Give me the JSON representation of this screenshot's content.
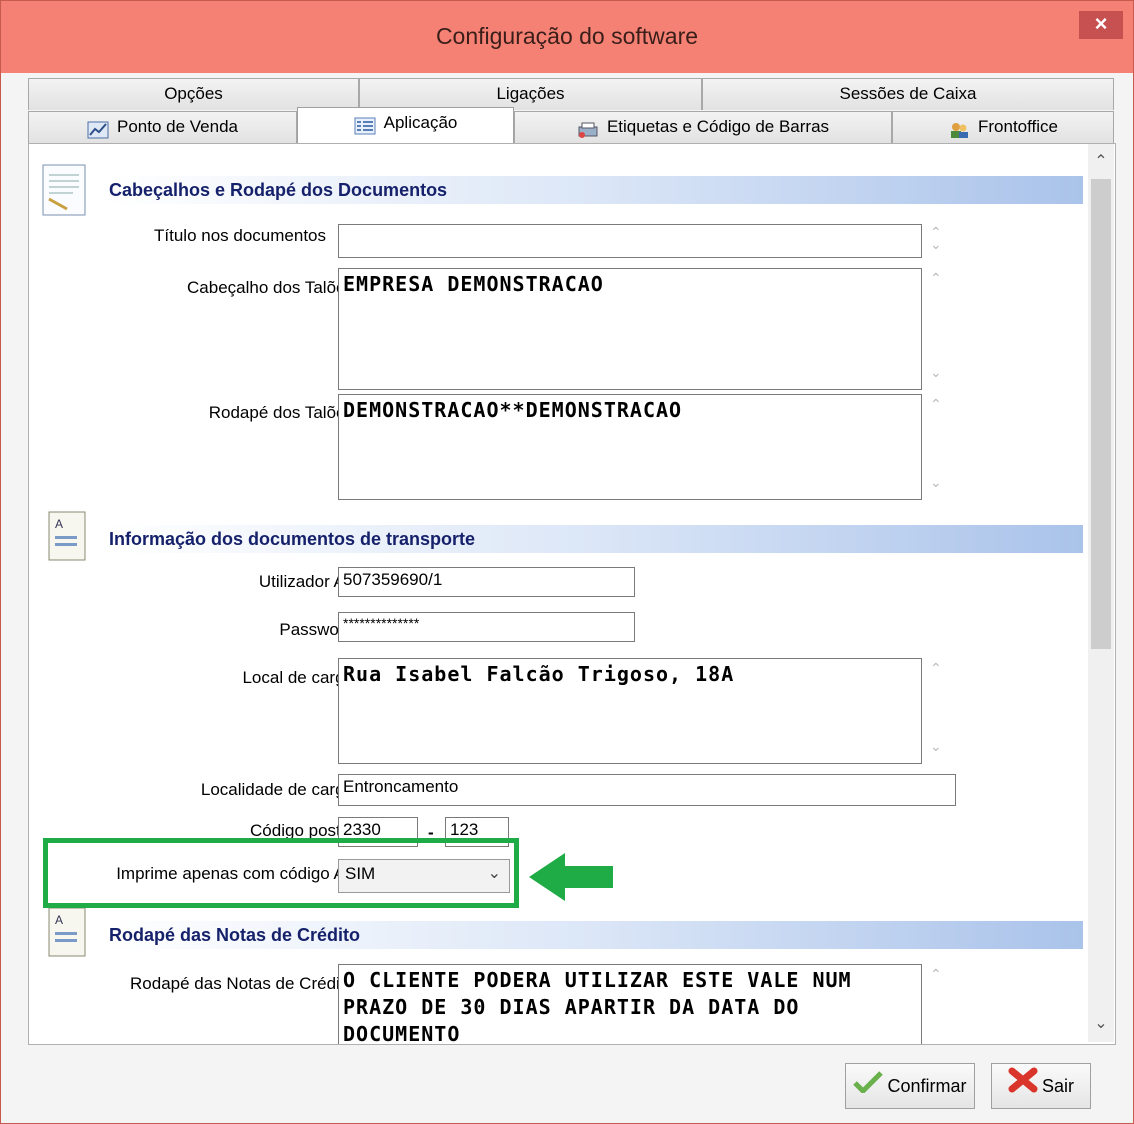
{
  "window": {
    "title": "Configuração do software",
    "close_label": "×"
  },
  "tabs_row1": [
    {
      "label": "Opções"
    },
    {
      "label": "Ligações"
    },
    {
      "label": "Sessões de Caixa"
    }
  ],
  "tabs_row2": [
    {
      "label": "Ponto de Venda",
      "icon": "chart-icon"
    },
    {
      "label": "Aplicação",
      "icon": "list-icon",
      "active": true
    },
    {
      "label": "Etiquetas e Código de Barras",
      "icon": "printer-icon"
    },
    {
      "label": "Frontoffice",
      "icon": "users-icon"
    }
  ],
  "sections": {
    "headers": "Cabeçalhos e Rodapé dos Documentos",
    "transport": "Informação dos documentos de transporte",
    "credit": "Rodapé das Notas de Crédito"
  },
  "fields": {
    "titulo_label": "Título nos documentos",
    "titulo_value": "",
    "cabecalho_label": "Cabeçalho dos Talões",
    "cabecalho_value": "EMPRESA DEMONSTRACAO",
    "rodape_label": "Rodapé dos Talões",
    "rodape_value": "DEMONSTRACAO**DEMONSTRACAO",
    "utilizador_label": "Utilizador AT",
    "utilizador_value": "507359690/1",
    "password_label": "Password",
    "password_value": "**************",
    "local_label": "Local de carga",
    "local_value": "Rua Isabel Falcão Trigoso, 18A",
    "localidade_label": "Localidade de carga",
    "localidade_value": "Entroncamento",
    "postal_label": "Código postal",
    "postal_value1": "2330",
    "postal_sep": "-",
    "postal_value2": "123",
    "imprime_label": "Imprime apenas com código AT",
    "imprime_value": "SIM",
    "credito_label": "Rodapé das Notas de Crédito",
    "credito_value": "O CLIENTE PODERA UTILIZAR ESTE VALE NUM PRAZO DE 30 DIAS APARTIR DA DATA DO DOCUMENTO"
  },
  "buttons": {
    "confirm": "Confirmar",
    "exit": "Sair"
  },
  "colors": {
    "titlebar": "#f48173",
    "highlight": "#1fab45",
    "section_text": "#16216b"
  }
}
